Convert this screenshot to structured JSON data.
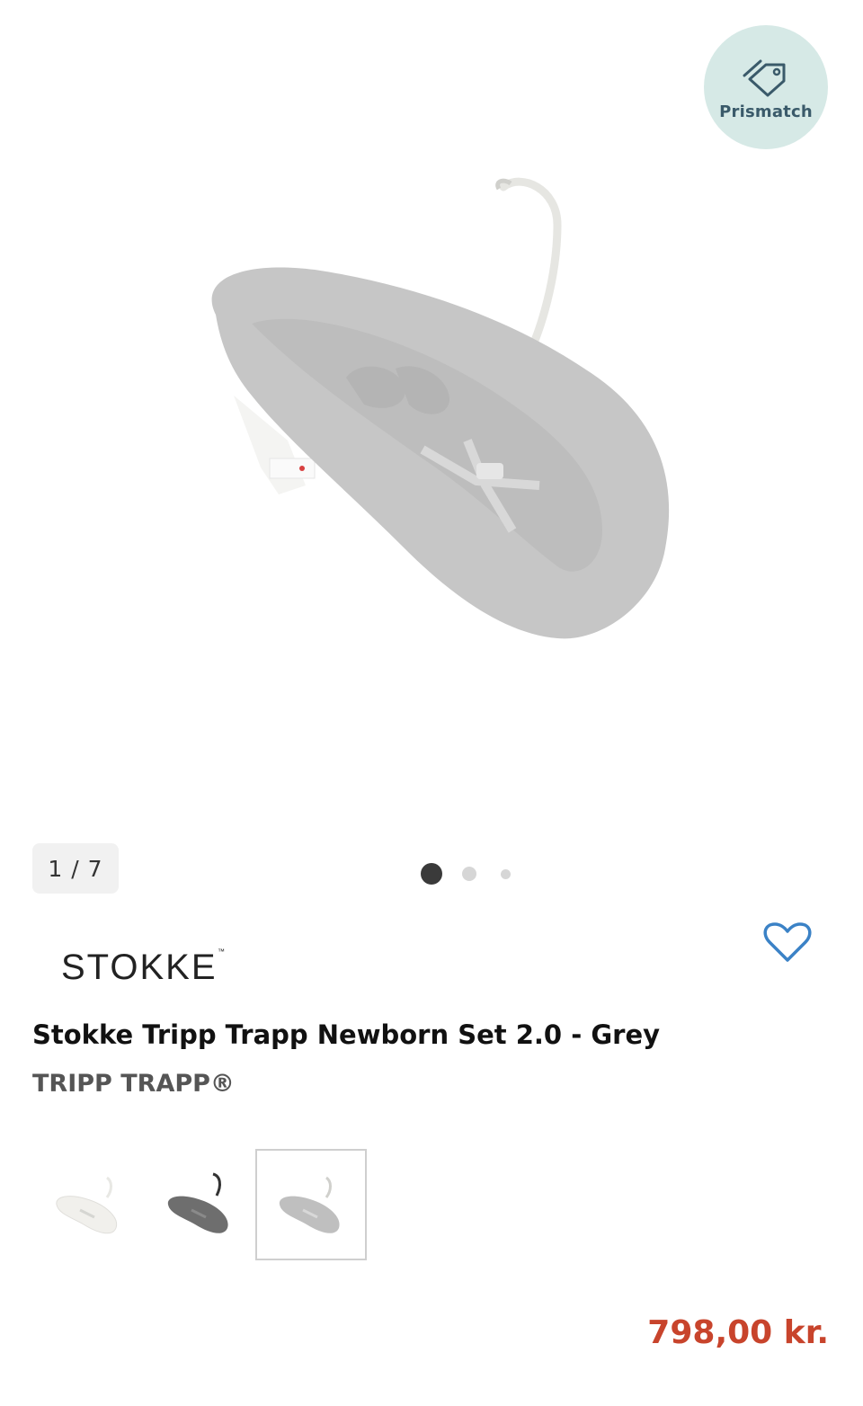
{
  "badge": {
    "label": "Prismatch",
    "icon": "price-tag-icon",
    "background": "#d6e9e6"
  },
  "gallery": {
    "counter": "1 / 7",
    "dots": 3,
    "active_dot": 0,
    "image": "newborn-set-grey-image"
  },
  "product": {
    "brand": "STOKKE",
    "brand_mark": "™",
    "title": "Stokke Tripp Trapp Newborn Set 2.0 - Grey",
    "subtitle": "TRIPP TRAPP®",
    "price": "798,00 kr.",
    "price_color": "#c8442c"
  },
  "favorite": {
    "icon": "heart-outline-icon",
    "color": "#3b82c6"
  },
  "variants": [
    {
      "name": "white",
      "icon": "newborn-set-white-thumbnail"
    },
    {
      "name": "dark-grey",
      "icon": "newborn-set-dark-grey-thumbnail"
    },
    {
      "name": "grey",
      "icon": "newborn-set-grey-thumbnail",
      "selected": true
    }
  ]
}
